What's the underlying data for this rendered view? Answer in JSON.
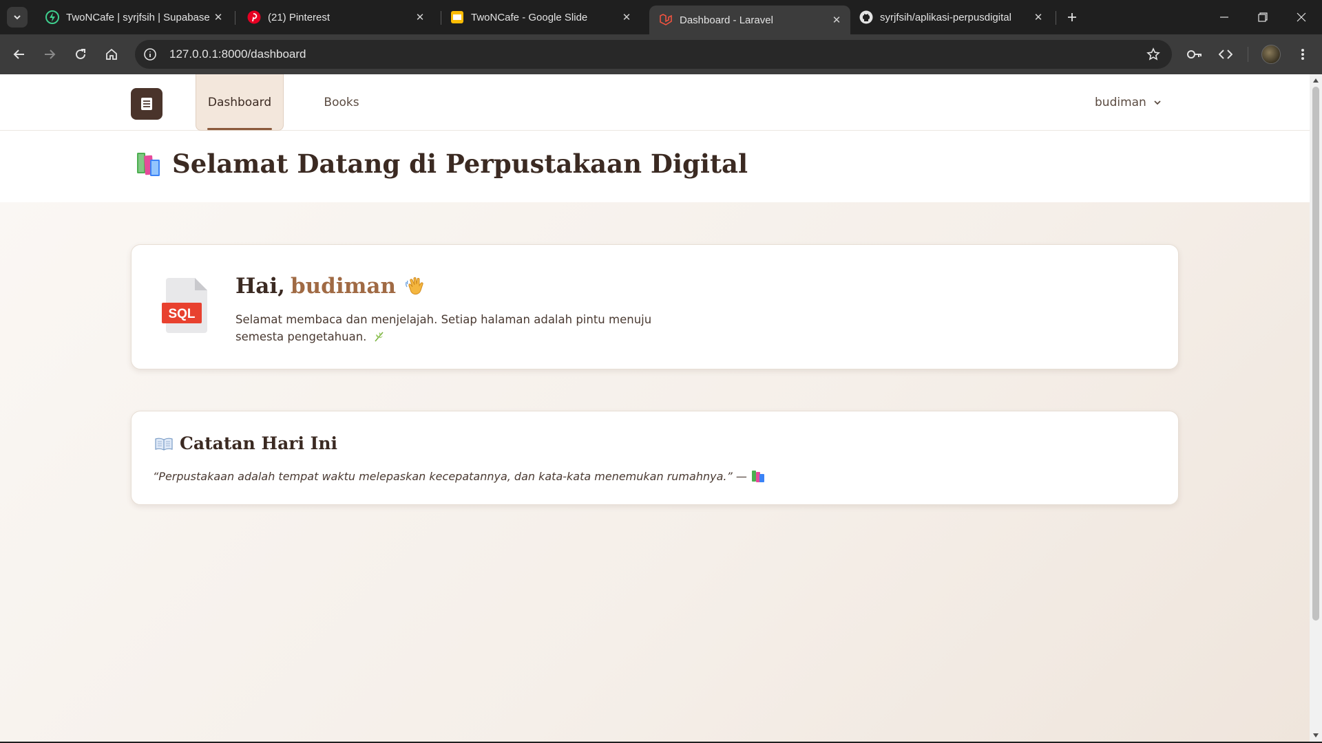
{
  "browser": {
    "tabs": [
      {
        "title": "TwoNCafe | syrjfsih | Supabase",
        "icon": "supabase-icon"
      },
      {
        "title": "(21) Pinterest",
        "icon": "pinterest-icon"
      },
      {
        "title": "TwoNCafe - Google Slide",
        "icon": "google-slides-icon"
      },
      {
        "title": "Dashboard - Laravel",
        "icon": "laravel-icon",
        "active": true
      },
      {
        "title": "syrjfsih/aplikasi-perpusdigital",
        "icon": "github-icon"
      }
    ],
    "url": "127.0.0.1:8000/dashboard"
  },
  "app": {
    "nav": {
      "dashboard_label": "Dashboard",
      "books_label": "Books",
      "user_name": "budiman"
    },
    "header": {
      "title": "Selamat Datang di Perpustakaan Digital"
    },
    "welcome_card": {
      "greeting_prefix": "Hai,",
      "user_name": "budiman",
      "message": "Selamat membaca dan menjelajah. Setiap halaman adalah pintu menuju semesta pengetahuan.",
      "sql_label": "SQL"
    },
    "quote_card": {
      "title": "Catatan Hari Ini",
      "quote": "“Perpustakaan adalah tempat waktu melepaskan kecepatannya, dan kata-kata menemukan rumahnya.” —"
    }
  },
  "colors": {
    "accent_brown": "#4a342b",
    "name_highlight": "#a06a44",
    "active_tab_bg": "#f3e7dc"
  }
}
